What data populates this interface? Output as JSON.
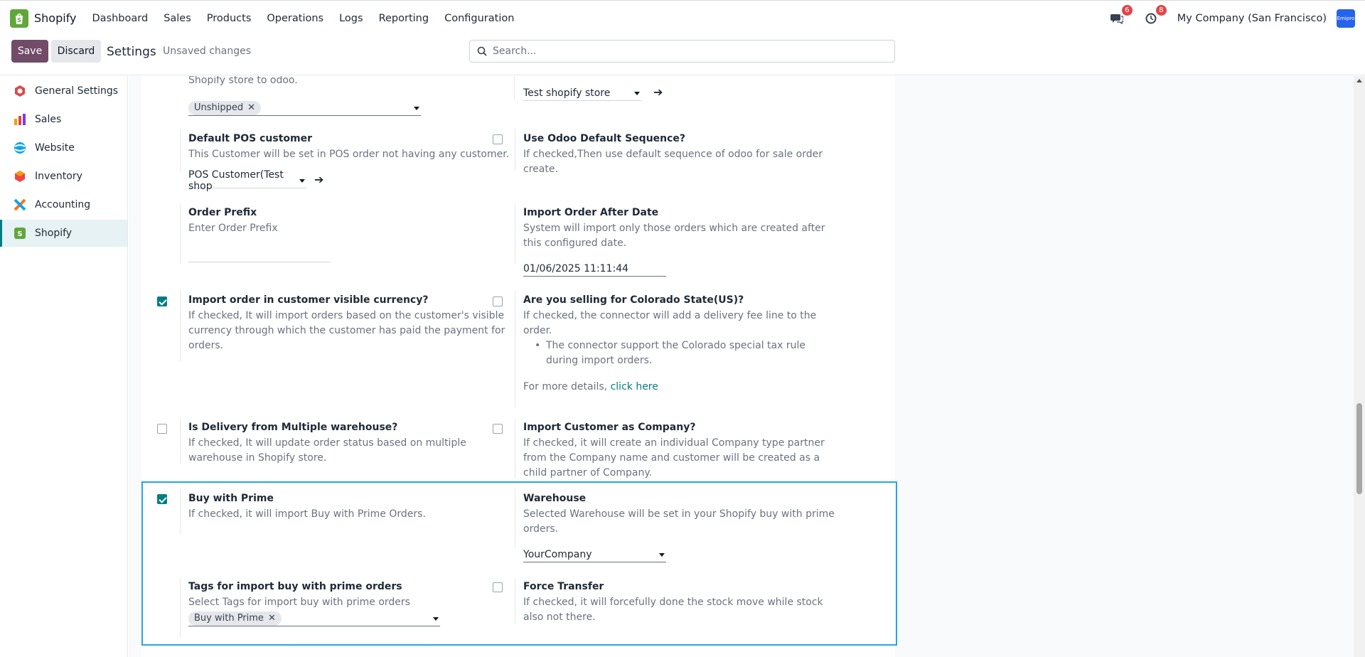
{
  "nav": {
    "app_name": "Shopify",
    "menu": [
      "Dashboard",
      "Sales",
      "Products",
      "Operations",
      "Logs",
      "Reporting",
      "Configuration"
    ],
    "messages_badge": "6",
    "activities_badge": "8",
    "company": "My Company (San Francisco)",
    "avatar_text": "Emipro"
  },
  "control": {
    "save_label": "Save",
    "discard_label": "Discard",
    "title": "Settings",
    "unsaved": "Unsaved changes",
    "search_placeholder": "Search..."
  },
  "sidebar": {
    "items": [
      {
        "label": "General Settings",
        "icon": "general-settings-icon",
        "color": "#e0464a"
      },
      {
        "label": "Sales",
        "icon": "sales-icon",
        "color": "#f59e0b"
      },
      {
        "label": "Website",
        "icon": "website-icon",
        "color": "#0ea5e9"
      },
      {
        "label": "Inventory",
        "icon": "inventory-icon",
        "color": "#ef4444"
      },
      {
        "label": "Accounting",
        "icon": "accounting-icon",
        "color": "#f97316"
      },
      {
        "label": "Shopify",
        "icon": "shopify-icon",
        "color": "#5fa73b"
      }
    ]
  },
  "settings": {
    "top_desc": "Shopify store to odoo.",
    "unshipped_tag": "Unshipped",
    "store_value": "Test shopify store",
    "pos_customer": {
      "title": "Default POS customer",
      "desc": "This Customer will be set in POS order not having any customer.",
      "value": "POS Customer(Test shop"
    },
    "odoo_sequence": {
      "title": "Use Odoo Default Sequence?",
      "desc1": "If checked,Then use default sequence of odoo for sale order",
      "desc2": "create."
    },
    "order_prefix": {
      "title": "Order Prefix",
      "desc": "Enter Order Prefix"
    },
    "import_after_date": {
      "title": "Import Order After Date",
      "desc1": "System will import only those orders which are created after",
      "desc2": "this configured date.",
      "value": "01/06/2025 11:11:44"
    },
    "visible_currency": {
      "title": "Import order in customer visible currency?",
      "desc1": "If checked, It will import orders based on the customer's visible",
      "desc2": "currency through which the customer has paid the payment for",
      "desc3": "orders."
    },
    "colorado": {
      "title": "Are you selling for Colorado State(US)?",
      "desc1": "If checked, the connector will add a delivery fee line to the",
      "desc2": "order.",
      "bullet1": "The connector support the Colorado special tax rule",
      "bullet2": "during import orders.",
      "more": "For more details, ",
      "link": "click here"
    },
    "multi_warehouse": {
      "title": "Is Delivery from Multiple warehouse?",
      "desc1": "If checked, It will update order status based on multiple",
      "desc2": "warehouse in Shopify store."
    },
    "customer_company": {
      "title": "Import Customer as Company?",
      "desc1": "If checked, it will create an individual Company type partner",
      "desc2": "from the Company name and customer will be created as a",
      "desc3": "child partner of Company."
    },
    "buy_with_prime": {
      "title": "Buy with Prime",
      "desc": "If checked, it will import Buy with Prime Orders."
    },
    "warehouse": {
      "title": "Warehouse",
      "desc1": "Selected Warehouse will be set in your Shopify buy with prime",
      "desc2": "orders.",
      "value": "YourCompany"
    },
    "prime_tags": {
      "title": "Tags for import buy with prime orders",
      "desc": "Select Tags for import buy with prime orders",
      "tag": "Buy with Prime"
    },
    "force_transfer": {
      "title": "Force Transfer",
      "desc1": "If checked, it will forcefully done the stock move while stock",
      "desc2": "also not there."
    }
  },
  "colors": {
    "primary": "#714b67",
    "accent": "#017e84",
    "highlight": "#26a5e5",
    "badge": "#e0464a"
  }
}
